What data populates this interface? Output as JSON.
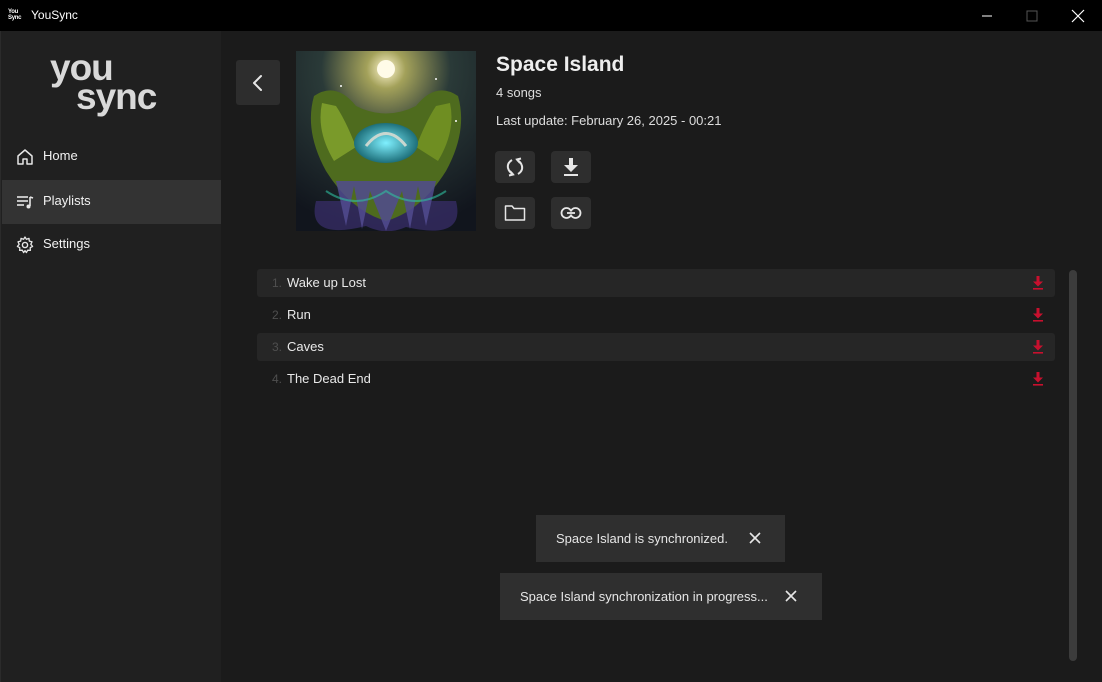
{
  "window": {
    "title": "YouSync",
    "icon_text_1": "You",
    "icon_text_2": "Sync"
  },
  "sidebar": {
    "logo_line1": "you",
    "logo_line2": "sync",
    "items": [
      {
        "label": "Home",
        "icon": "home-icon",
        "active": false
      },
      {
        "label": "Playlists",
        "icon": "playlist-icon",
        "active": true
      },
      {
        "label": "Settings",
        "icon": "gear-icon",
        "active": false
      }
    ]
  },
  "playlist": {
    "title": "Space Island",
    "song_count": "4 songs",
    "last_update": "Last update: February 26, 2025 - 00:21",
    "songs": [
      {
        "num": "1.",
        "title": "Wake up Lost"
      },
      {
        "num": "2.",
        "title": "Run"
      },
      {
        "num": "3.",
        "title": "Caves"
      },
      {
        "num": "4.",
        "title": "The Dead End"
      }
    ]
  },
  "toasts": [
    {
      "text": "Space Island is synchronized."
    },
    {
      "text": "Space Island synchronization in progress..."
    }
  ],
  "colors": {
    "accent_download": "#c8102e",
    "sidebar_active": "#333333",
    "background": "#1b1b1b"
  }
}
